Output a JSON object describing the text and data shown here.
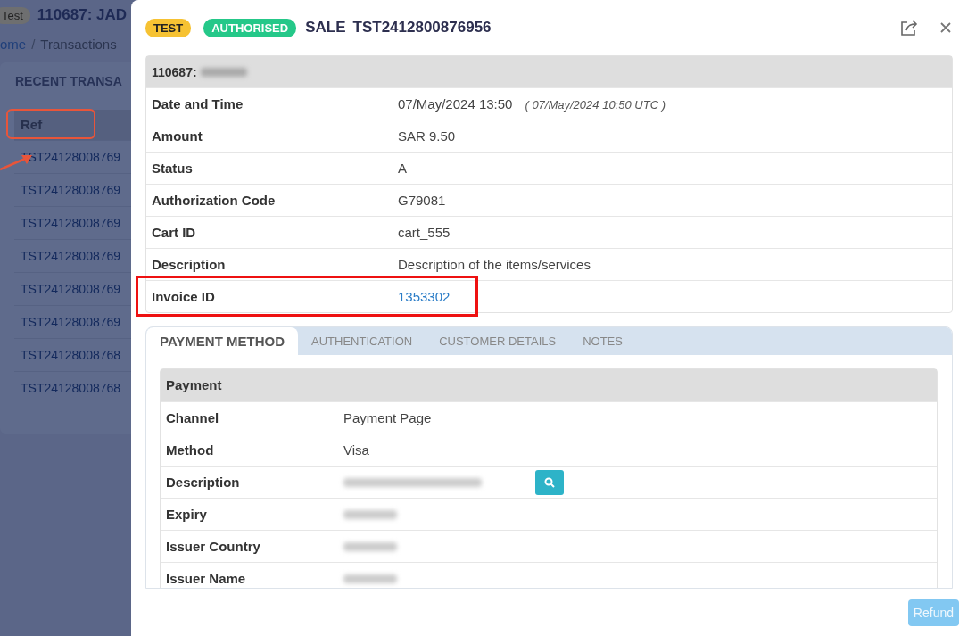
{
  "background_page": {
    "badge": "Test",
    "title": "110687: JAD",
    "breadcrumb": [
      {
        "label": "ome",
        "separator": "/"
      },
      {
        "label": "Transactions"
      }
    ],
    "section_title": "RECENT TRANSA",
    "table": {
      "columns": [
        {
          "label": "Ref",
          "highlighted": true
        }
      ],
      "rows": [
        {
          "ref": "TST24128008769",
          "pointed": true
        },
        {
          "ref": "TST24128008769",
          "pointed": false
        },
        {
          "ref": "TST24128008769",
          "pointed": false
        },
        {
          "ref": "TST24128008769",
          "pointed": false
        },
        {
          "ref": "TST24128008769",
          "pointed": false
        },
        {
          "ref": "TST24128008769",
          "pointed": false
        },
        {
          "ref": "TST24128008768",
          "pointed": false
        },
        {
          "ref": "TST24128008768",
          "pointed": false
        }
      ]
    }
  },
  "modal": {
    "badges": [
      {
        "label": "TEST",
        "kind": "test"
      },
      {
        "label": "AUTHORISED",
        "kind": "status"
      }
    ],
    "type": "SALE",
    "ref": "TST2412800876956",
    "details": {
      "header": "110687:",
      "header_redacted": true,
      "rows": [
        {
          "label": "Date and Time",
          "value": "07/May/2024 13:50",
          "note": "( 07/May/2024 10:50 UTC )",
          "kind": "text",
          "highlighted": false
        },
        {
          "label": "Amount",
          "value": "SAR 9.50",
          "kind": "text",
          "highlighted": false
        },
        {
          "label": "Status",
          "value": "A",
          "kind": "text",
          "highlighted": false
        },
        {
          "label": "Authorization Code",
          "value": "G79081",
          "kind": "text",
          "highlighted": false
        },
        {
          "label": "Cart ID",
          "value": "cart_555",
          "kind": "text",
          "highlighted": false
        },
        {
          "label": "Description",
          "value": "Description of the items/services",
          "kind": "text",
          "highlighted": false
        },
        {
          "label": "Invoice ID",
          "value": "1353302",
          "kind": "link",
          "highlighted": true
        }
      ]
    },
    "tabs": [
      {
        "label": "PAYMENT METHOD",
        "selected": true
      },
      {
        "label": "AUTHENTICATION",
        "selected": false
      },
      {
        "label": "CUSTOMER DETAILS",
        "selected": false
      },
      {
        "label": "NOTES",
        "selected": false
      }
    ],
    "payment": {
      "header": "Payment",
      "rows": [
        {
          "label": "Channel",
          "value": "Payment Page",
          "kind": "text"
        },
        {
          "label": "Method",
          "value": "Visa",
          "kind": "text"
        },
        {
          "label": "Description",
          "kind": "redacted",
          "search_button": true
        },
        {
          "label": "Expiry",
          "kind": "redacted"
        },
        {
          "label": "Issuer Country",
          "kind": "redacted"
        },
        {
          "label": "Issuer Name",
          "kind": "redacted"
        }
      ]
    },
    "refund_button": {
      "label": "Refund",
      "disabled": true
    }
  }
}
